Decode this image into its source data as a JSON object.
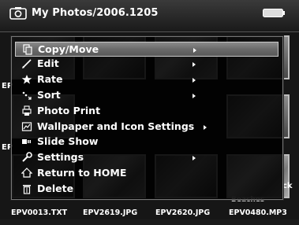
{
  "header": {
    "title": "My Photos/2006.1205",
    "camera_icon": "camera-icon",
    "battery_icon": "battery-icon"
  },
  "thumbnails": {
    "side_labels": [
      "EP",
      "EP"
    ],
    "overlay_text": [
      "Beaches",
      "ck"
    ]
  },
  "files": [
    "EPV0013.TXT",
    "EPV2619.JPG",
    "EPV2620.JPG",
    "EPV0480.MP3"
  ],
  "menu": {
    "items": [
      {
        "label": "Copy/Move",
        "icon": "copy-icon",
        "submenu": true,
        "selected": true
      },
      {
        "label": "Edit",
        "icon": "pencil-icon",
        "submenu": true
      },
      {
        "label": "Rate",
        "icon": "star-icon",
        "submenu": true
      },
      {
        "label": "Sort",
        "icon": "sort-icon",
        "submenu": true
      },
      {
        "label": "Photo Print",
        "icon": "printer-icon",
        "submenu": false
      },
      {
        "label": "Wallpaper and Icon Settings",
        "icon": "wallpaper-icon",
        "submenu": true
      },
      {
        "label": "Slide Show",
        "icon": "slideshow-icon",
        "submenu": false
      },
      {
        "label": "Settings",
        "icon": "wrench-icon",
        "submenu": true
      },
      {
        "label": "Return to HOME",
        "icon": "home-icon",
        "submenu": false
      },
      {
        "label": "Delete",
        "icon": "trash-icon",
        "submenu": false
      }
    ]
  },
  "colors": {
    "background": "#161616",
    "menu_background": "#000000",
    "selected_row": "#7a7a7a",
    "text": "#ffffff"
  }
}
